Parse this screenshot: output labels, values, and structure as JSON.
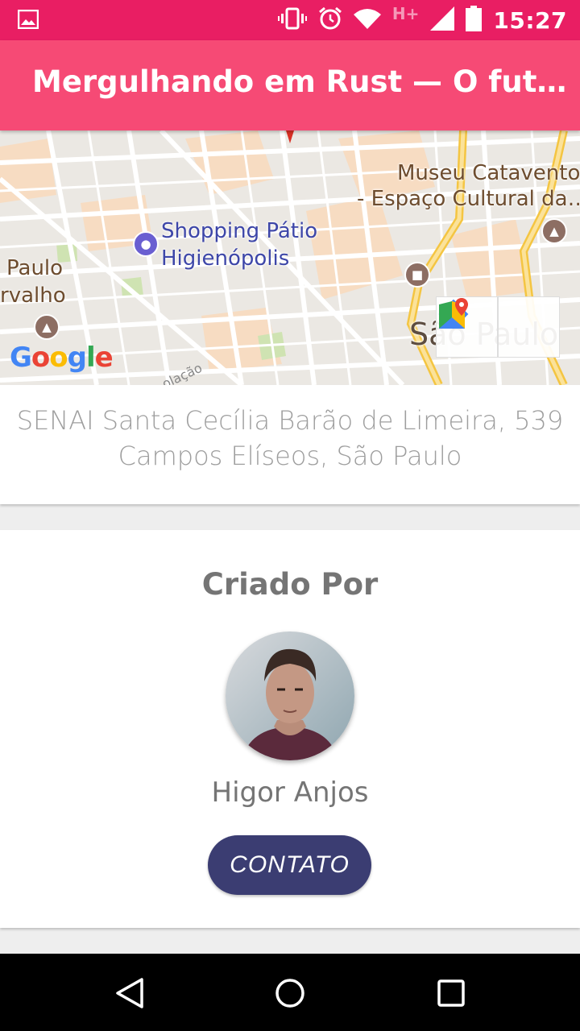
{
  "status_bar": {
    "network_type": "H+",
    "time": "15:27",
    "icons": [
      "gallery-icon",
      "vibrate-icon",
      "alarm-icon",
      "wifi-icon",
      "signal-icon",
      "battery-icon"
    ]
  },
  "app_bar": {
    "title": "Mergulhando em Rust — O futuro da…"
  },
  "map": {
    "labels": {
      "museu_line1": "Museu Catavento",
      "museu_line2": "- Espaço Cultural da…",
      "shopping_line1": "Shopping Pátio",
      "shopping_line2": "Higienópolis",
      "paulo": "Paulo",
      "rvalho": "rvalho",
      "sao_paulo": "São Paulo",
      "street": "olação"
    },
    "google_logo": {
      "letters": [
        "G",
        "o",
        "o",
        "g",
        "l",
        "e"
      ],
      "colors": [
        "#4285F4",
        "#EA4335",
        "#FBBC05",
        "#4285F4",
        "#34A853",
        "#EA4335"
      ]
    }
  },
  "address": {
    "line1": "SENAI Santa Cecília Barão de Limeira, 539",
    "line2": "Campos Elíseos, São Paulo"
  },
  "creator": {
    "section_title": "Criado Por",
    "name": "Higor Anjos",
    "contact_label": "CONTATO"
  },
  "colors": {
    "status_bar": "#e91e63",
    "app_bar": "#f64a75",
    "contact_button": "#3b3d72"
  }
}
